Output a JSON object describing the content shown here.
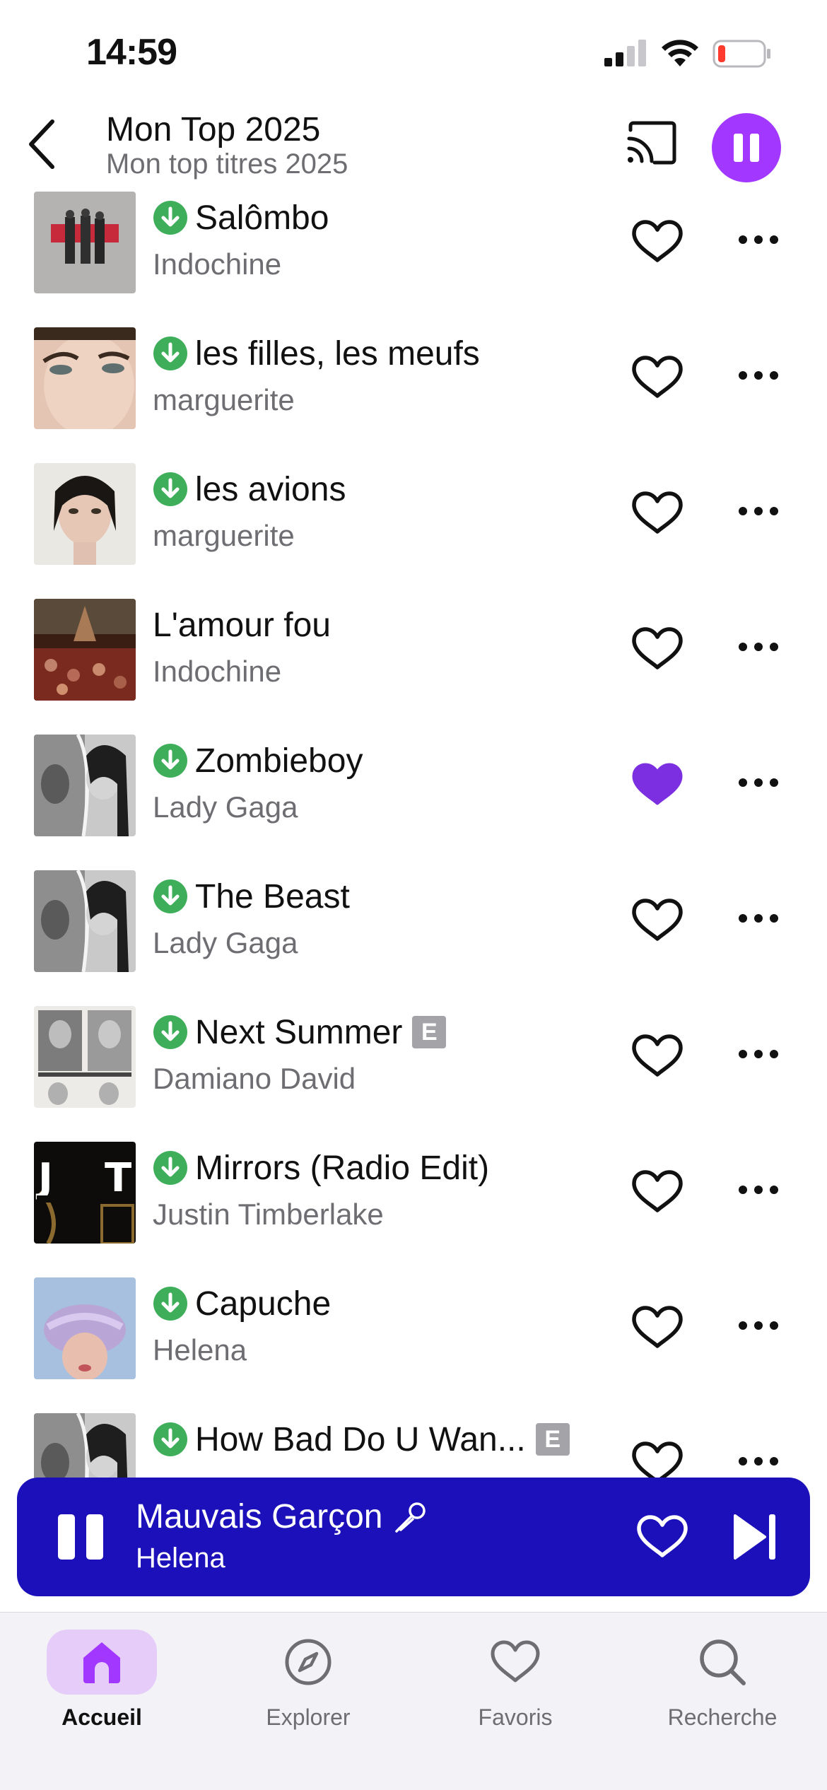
{
  "status_bar": {
    "time": "14:59"
  },
  "header": {
    "title": "Mon Top 2025",
    "subtitle": "Mon top titres 2025"
  },
  "tracks": [
    {
      "title": "Salômbo",
      "artist": "Indochine",
      "downloaded": true,
      "liked": false,
      "explicit": false
    },
    {
      "title": "les filles, les meufs",
      "artist": "marguerite",
      "downloaded": true,
      "liked": false,
      "explicit": false
    },
    {
      "title": "les avions",
      "artist": "marguerite",
      "downloaded": true,
      "liked": false,
      "explicit": false
    },
    {
      "title": "L'amour fou",
      "artist": "Indochine",
      "downloaded": false,
      "liked": false,
      "explicit": false
    },
    {
      "title": "Zombieboy",
      "artist": "Lady Gaga",
      "downloaded": true,
      "liked": true,
      "explicit": false
    },
    {
      "title": "The Beast",
      "artist": "Lady Gaga",
      "downloaded": true,
      "liked": false,
      "explicit": false
    },
    {
      "title": "Next Summer",
      "artist": "Damiano David",
      "downloaded": true,
      "liked": false,
      "explicit": true
    },
    {
      "title": "Mirrors (Radio Edit)",
      "artist": "Justin Timberlake",
      "downloaded": true,
      "liked": false,
      "explicit": false
    },
    {
      "title": "Capuche",
      "artist": "Helena",
      "downloaded": true,
      "liked": false,
      "explicit": false
    },
    {
      "title": "How Bad Do U Wan...",
      "artist": "",
      "downloaded": true,
      "liked": false,
      "explicit": true
    }
  ],
  "explicit_label": "E",
  "mini_player": {
    "title": "Mauvais Garçon",
    "artist": "Helena"
  },
  "tabs": [
    {
      "label": "Accueil",
      "icon": "home-icon",
      "active": true
    },
    {
      "label": "Explorer",
      "icon": "compass-icon",
      "active": false
    },
    {
      "label": "Favoris",
      "icon": "heart-icon",
      "active": false
    },
    {
      "label": "Recherche",
      "icon": "search-icon",
      "active": false
    }
  ],
  "colors": {
    "accent": "#a238ff",
    "liked": "#7b2fe0",
    "download": "#3fae5a",
    "mini_player_bg": "#1b10b9",
    "tab_active_bg": "#e6cdf9"
  }
}
